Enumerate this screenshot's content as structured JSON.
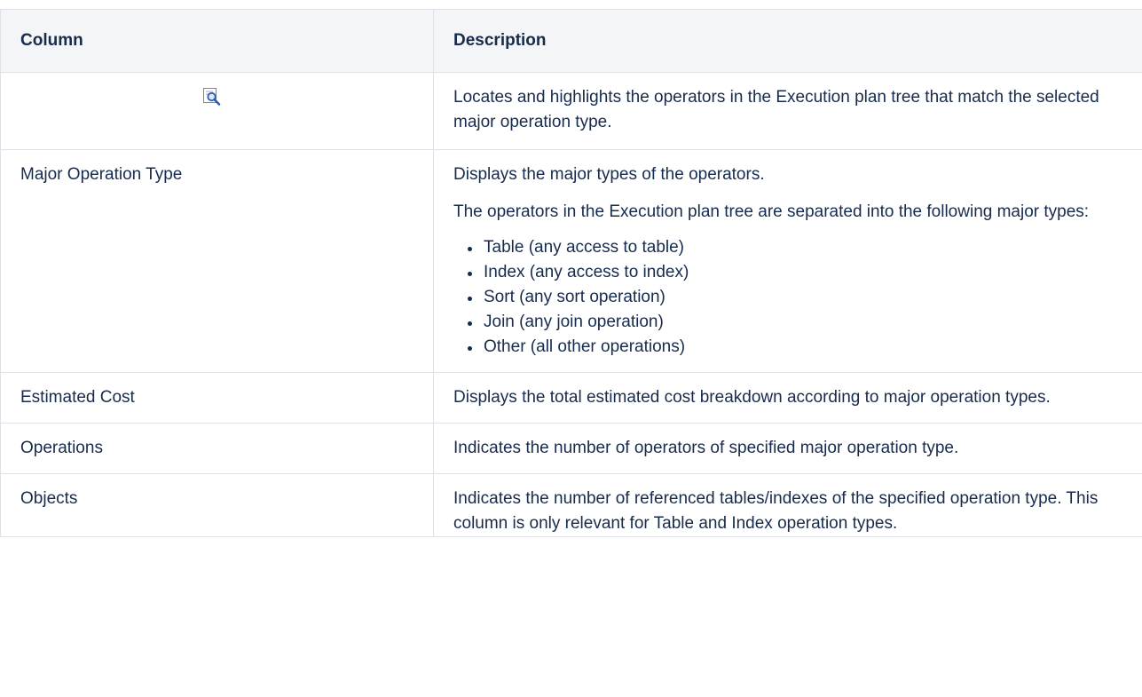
{
  "table": {
    "headers": {
      "column": "Column",
      "description": "Description"
    },
    "rows": [
      {
        "column_icon": "locate-highlight-icon",
        "description": "Locates and highlights the operators in the Execution plan tree that match the selected major operation type."
      },
      {
        "column": "Major Operation Type",
        "description_paragraphs": [
          "Displays the major types of the operators.",
          "The operators in the Execution plan tree are separated into the following major types:"
        ],
        "list_items": [
          "Table (any access to table)",
          "Index (any access to index)",
          "Sort (any sort operation)",
          "Join (any join operation)",
          "Other (all other operations)"
        ]
      },
      {
        "column": "Estimated Cost",
        "description": "Displays the total estimated cost breakdown according to major operation types."
      },
      {
        "column": "Operations",
        "description": "Indicates the number of operators of specified major operation type."
      },
      {
        "column": "Objects",
        "description": "Indicates the number of referenced tables/indexes of the specified operation type. This column is only relevant for Table and Index operation types."
      }
    ]
  },
  "colors": {
    "text": "#172b4d",
    "header_background": "#f4f5f7",
    "border": "#dfe1e6",
    "icon_blue": "#2a5db0"
  }
}
